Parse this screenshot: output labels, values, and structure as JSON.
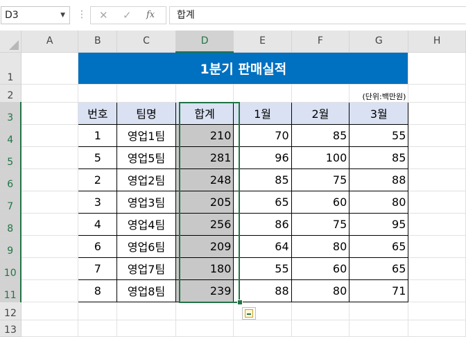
{
  "name_box": "D3",
  "formula_bar": {
    "cancel_icon": "✕",
    "enter_icon": "✓",
    "insert_function_label": "fx",
    "content": "합계"
  },
  "columns": [
    "A",
    "B",
    "C",
    "D",
    "E",
    "F",
    "G",
    "H"
  ],
  "rows": [
    "1",
    "2",
    "3",
    "4",
    "5",
    "6",
    "7",
    "8",
    "9",
    "10",
    "11",
    "12",
    "13"
  ],
  "sheet": {
    "title": "1분기 판매실적",
    "unit": "(단위:백만원)",
    "headers": [
      "번호",
      "팀명",
      "합계",
      "1월",
      "2월",
      "3월"
    ],
    "data": [
      [
        "1",
        "영업1팀",
        "210",
        "70",
        "85",
        "55"
      ],
      [
        "5",
        "영업5팀",
        "281",
        "96",
        "100",
        "85"
      ],
      [
        "2",
        "영업2팀",
        "248",
        "85",
        "75",
        "88"
      ],
      [
        "3",
        "영업3팀",
        "205",
        "65",
        "60",
        "80"
      ],
      [
        "4",
        "영업4팀",
        "256",
        "86",
        "75",
        "95"
      ],
      [
        "6",
        "영업6팀",
        "209",
        "64",
        "80",
        "65"
      ],
      [
        "7",
        "영업7팀",
        "180",
        "55",
        "60",
        "65"
      ],
      [
        "8",
        "영업8팀",
        "239",
        "88",
        "80",
        "71"
      ]
    ]
  },
  "selection": {
    "active_cell": "D3",
    "selected_column": "D"
  },
  "colors": {
    "title_fill": "#0070c0",
    "header_fill": "#d9e1f2",
    "selected_fill": "#c8c8c8",
    "selection_border": "#217346"
  }
}
